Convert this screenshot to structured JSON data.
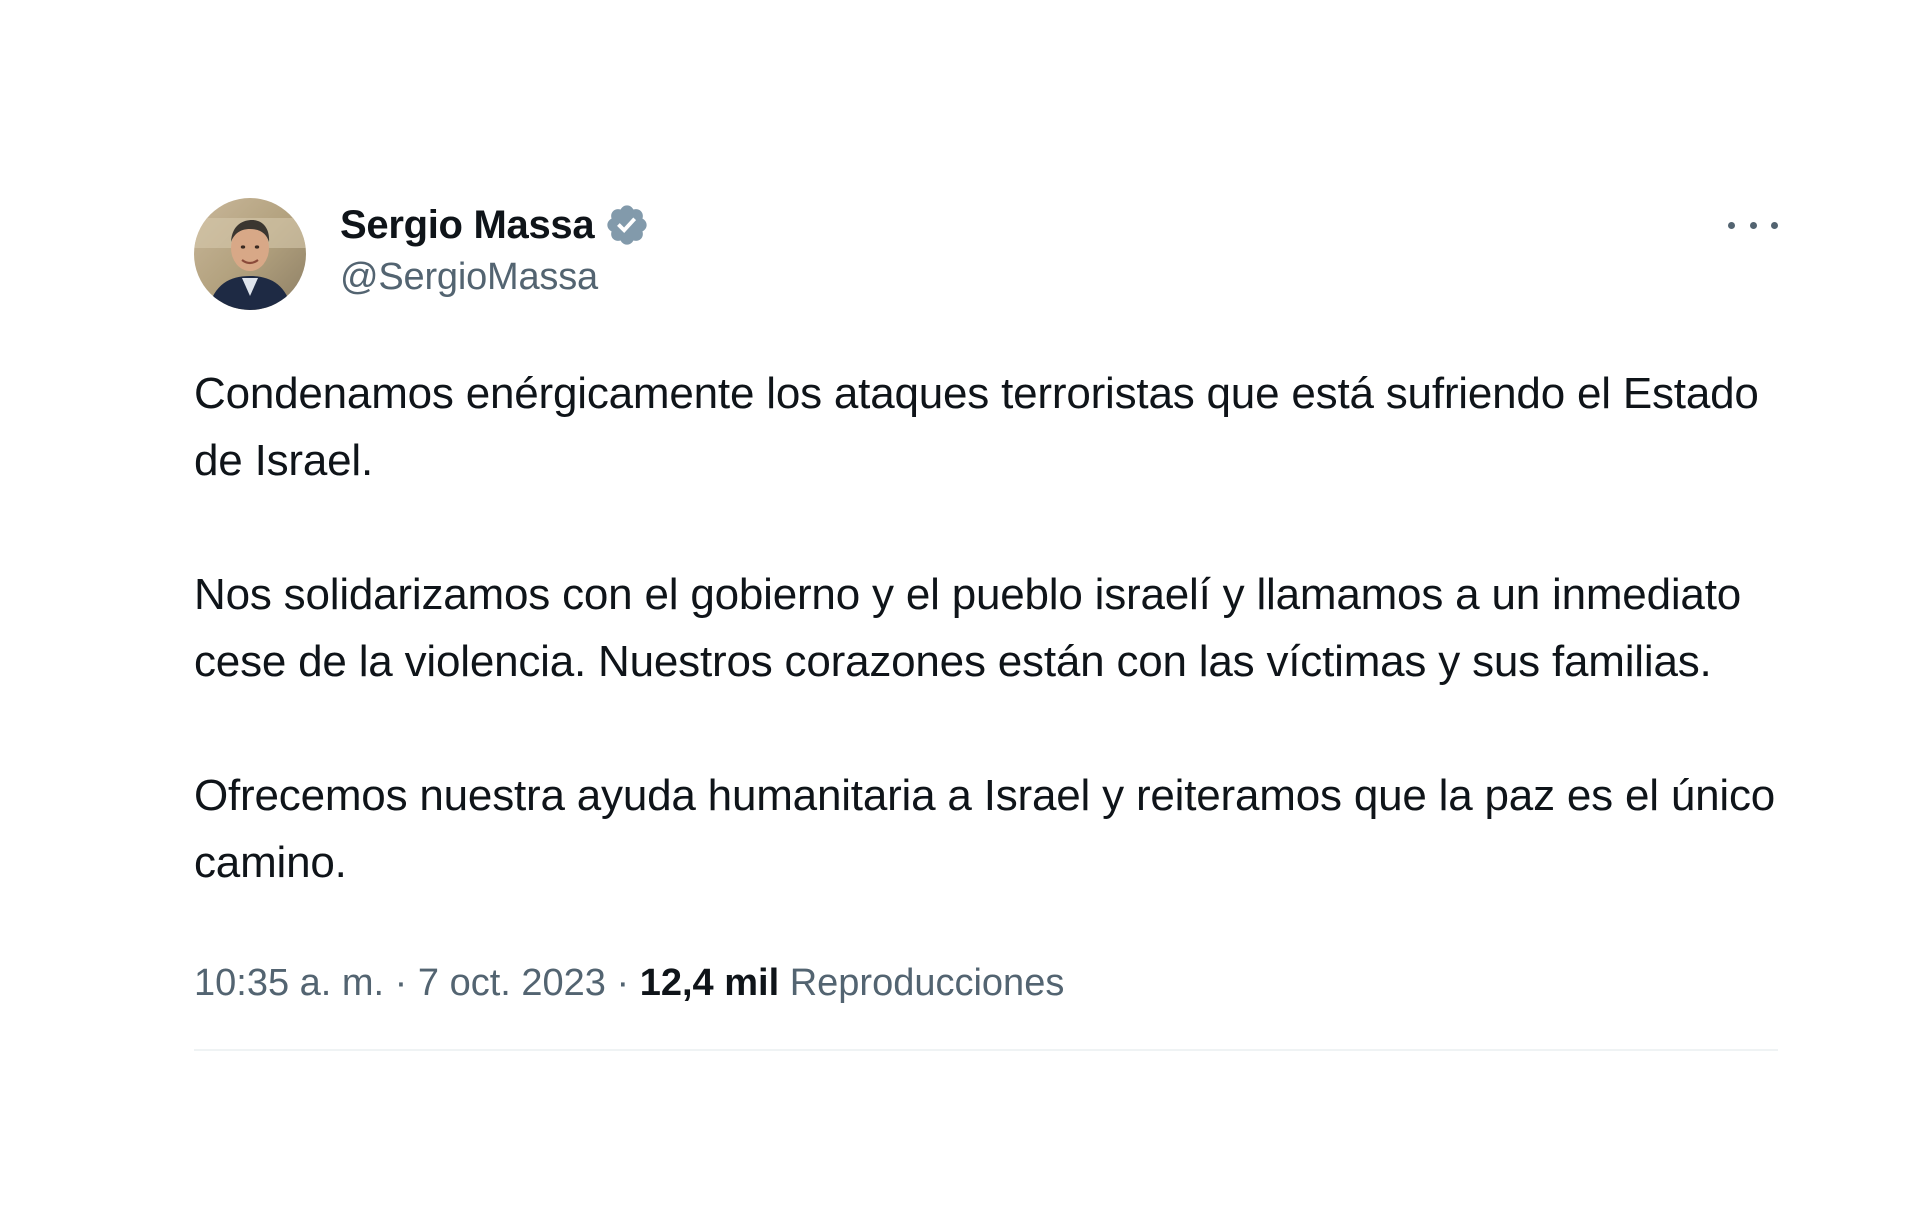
{
  "user": {
    "display_name": "Sergio Massa",
    "handle": "@SergioMassa",
    "verified_color": "#829aab"
  },
  "tweet": {
    "paragraphs": [
      "Condenamos enérgicamente los ataques terroristas que está sufriendo el Estado de Israel.",
      "Nos solidarizamos con el gobierno y el pueblo israelí y llamamos a un inmediato cese de la violencia. Nuestros corazones están con las víctimas y sus familias.",
      "Ofrecemos nuestra ayuda humanitaria a Israel y reiteramos que la paz es el único camino."
    ],
    "time": "10:35 a. m.",
    "separator": " · ",
    "date": "7 oct. 2023",
    "views_count": "12,4 mil",
    "views_label": "Reproducciones"
  },
  "icons": {
    "more": "more-horizontal-icon",
    "verified": "verified-badge-icon"
  },
  "colors": {
    "text_primary": "#0f1419",
    "text_secondary": "#536471",
    "divider": "#eff3f4"
  }
}
